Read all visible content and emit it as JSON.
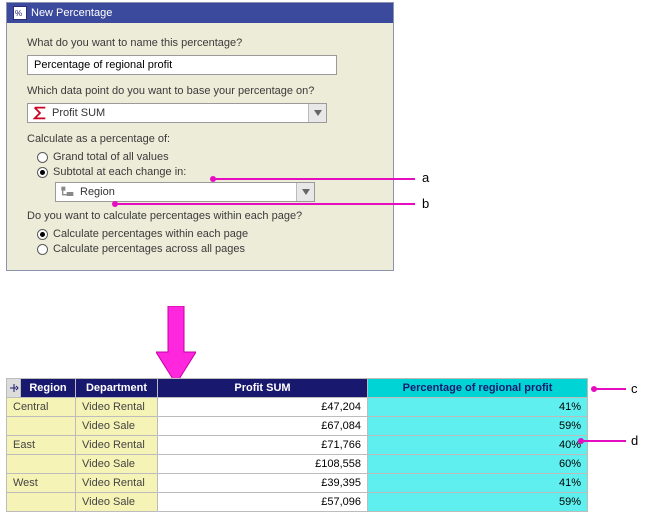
{
  "dialog": {
    "title": "New Percentage",
    "name_prompt": "What do you want to name this percentage?",
    "name_value": "Percentage of regional profit",
    "base_prompt": "Which data point do you want to base your percentage on?",
    "base_value": "Profit SUM",
    "calc_of_label": "Calculate as a percentage of:",
    "radio_grand": "Grand total of all values",
    "radio_subtotal": "Subtotal at each change in:",
    "subtotal_combo_value": "Region",
    "page_prompt": "Do you want to calculate percentages within each page?",
    "radio_within": "Calculate percentages within each page",
    "radio_across": "Calculate percentages across all pages"
  },
  "annotations": {
    "a": "a",
    "b": "b",
    "c": "c",
    "d": "d"
  },
  "table": {
    "headers": {
      "region": "Region",
      "department": "Department",
      "profit": "Profit SUM",
      "pct": "Percentage of regional profit"
    },
    "rows": [
      {
        "region": "Central",
        "department": "Video Rental",
        "profit": "£47,204",
        "pct": "41%"
      },
      {
        "region": "",
        "department": "Video Sale",
        "profit": "£67,084",
        "pct": "59%"
      },
      {
        "region": "East",
        "department": "Video Rental",
        "profit": "£71,766",
        "pct": "40%"
      },
      {
        "region": "",
        "department": "Video Sale",
        "profit": "£108,558",
        "pct": "60%"
      },
      {
        "region": "West",
        "department": "Video Rental",
        "profit": "£39,395",
        "pct": "41%"
      },
      {
        "region": "",
        "department": "Video Sale",
        "profit": "£57,096",
        "pct": "59%"
      }
    ]
  }
}
